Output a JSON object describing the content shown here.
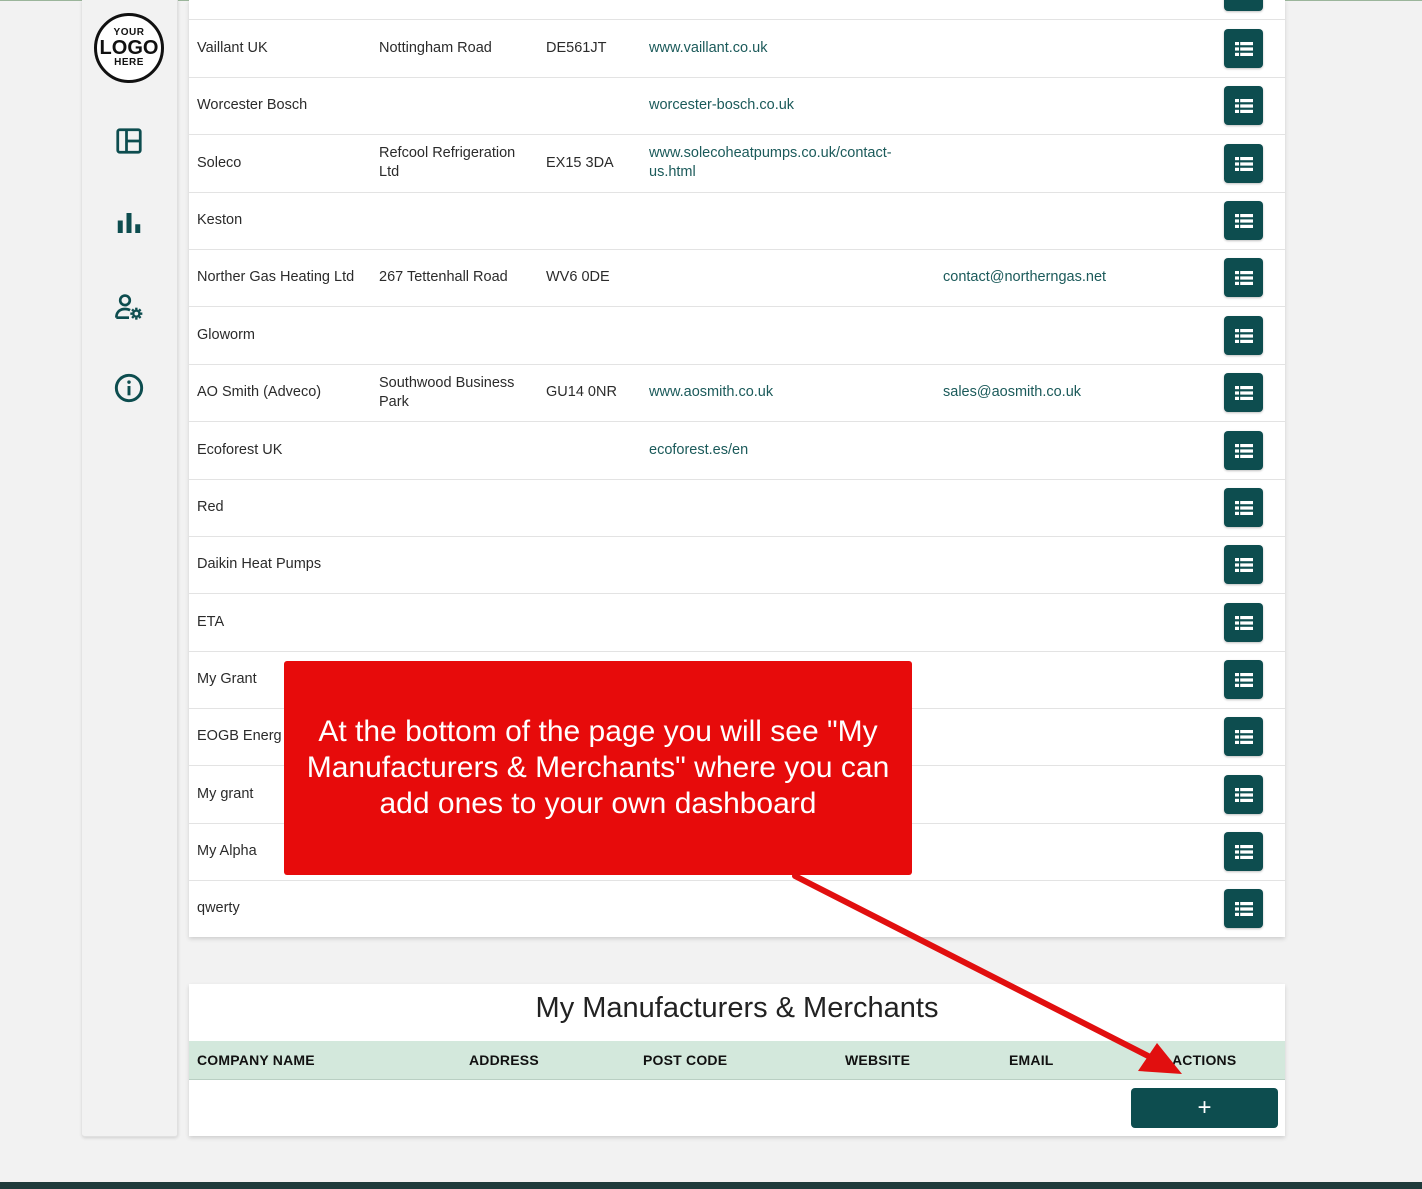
{
  "sidebar": {
    "logo": {
      "line1": "YOUR",
      "line2": "LOGO",
      "line3": "HERE"
    },
    "items": [
      {
        "name": "dashboard",
        "icon": "dashboard-layout-icon"
      },
      {
        "name": "reports",
        "icon": "bar-chart-icon"
      },
      {
        "name": "user-settings",
        "icon": "user-settings-icon"
      },
      {
        "name": "info",
        "icon": "info-icon"
      }
    ]
  },
  "manufacturers": {
    "rows": [
      {
        "name": "Vaillant UK",
        "address": "Nottingham Road",
        "postcode": "DE561JT",
        "website": "www.vaillant.co.uk",
        "email": ""
      },
      {
        "name": "Worcester Bosch",
        "address": "",
        "postcode": "",
        "website": "worcester-bosch.co.uk",
        "email": ""
      },
      {
        "name": "Soleco",
        "address": "Refcool Refrigeration Ltd",
        "postcode": "EX15 3DA",
        "website": "www.solecoheatpumps.co.uk/contact-us.html",
        "email": ""
      },
      {
        "name": "Keston",
        "address": "",
        "postcode": "",
        "website": "",
        "email": ""
      },
      {
        "name": "Norther Gas Heating Ltd",
        "address": "267 Tettenhall Road",
        "postcode": "WV6 0DE",
        "website": "",
        "email": "contact@northerngas.net"
      },
      {
        "name": "Gloworm",
        "address": "",
        "postcode": "",
        "website": "",
        "email": ""
      },
      {
        "name": "AO Smith (Adveco)",
        "address": "Southwood Business Park",
        "postcode": "GU14 0NR",
        "website": "www.aosmith.co.uk",
        "email": "sales@aosmith.co.uk"
      },
      {
        "name": "Ecoforest UK",
        "address": "",
        "postcode": "",
        "website": "ecoforest.es/en",
        "email": ""
      },
      {
        "name": "Red",
        "address": "",
        "postcode": "",
        "website": "",
        "email": ""
      },
      {
        "name": "Daikin Heat Pumps",
        "address": "",
        "postcode": "",
        "website": "",
        "email": ""
      },
      {
        "name": "ETA",
        "address": "",
        "postcode": "",
        "website": "",
        "email": ""
      },
      {
        "name": "My Grant",
        "address": "",
        "postcode": "",
        "website": "",
        "email": ""
      },
      {
        "name": "EOGB Energ Ltd",
        "address": "",
        "postcode": "",
        "website": "",
        "email": ""
      },
      {
        "name": "My grant",
        "address": "",
        "postcode": "",
        "website": "",
        "email": ""
      },
      {
        "name": "My Alpha",
        "address": "",
        "postcode": "",
        "website": "",
        "email": ""
      },
      {
        "name": "qwerty",
        "address": "",
        "postcode": "",
        "website": "",
        "email": ""
      }
    ],
    "action_icon": "list-view-icon"
  },
  "my_section": {
    "title": "My Manufacturers & Merchants",
    "headers": {
      "company_name": "COMPANY NAME",
      "address": "ADDRESS",
      "post_code": "POST CODE",
      "website": "WEBSITE",
      "email": "EMAIL",
      "actions": "ACTIONS"
    },
    "add_label": "+"
  },
  "callout": {
    "text": "At the bottom of the page you will see \"My Manufacturers & Merchants\" where you can add ones to your own dashboard"
  },
  "colors": {
    "accent": "#0d4d4f",
    "link": "#1b5a5a",
    "header_bg": "#d3e8dc",
    "callout_bg": "#e70b0b",
    "arrow": "#e10f0f"
  }
}
